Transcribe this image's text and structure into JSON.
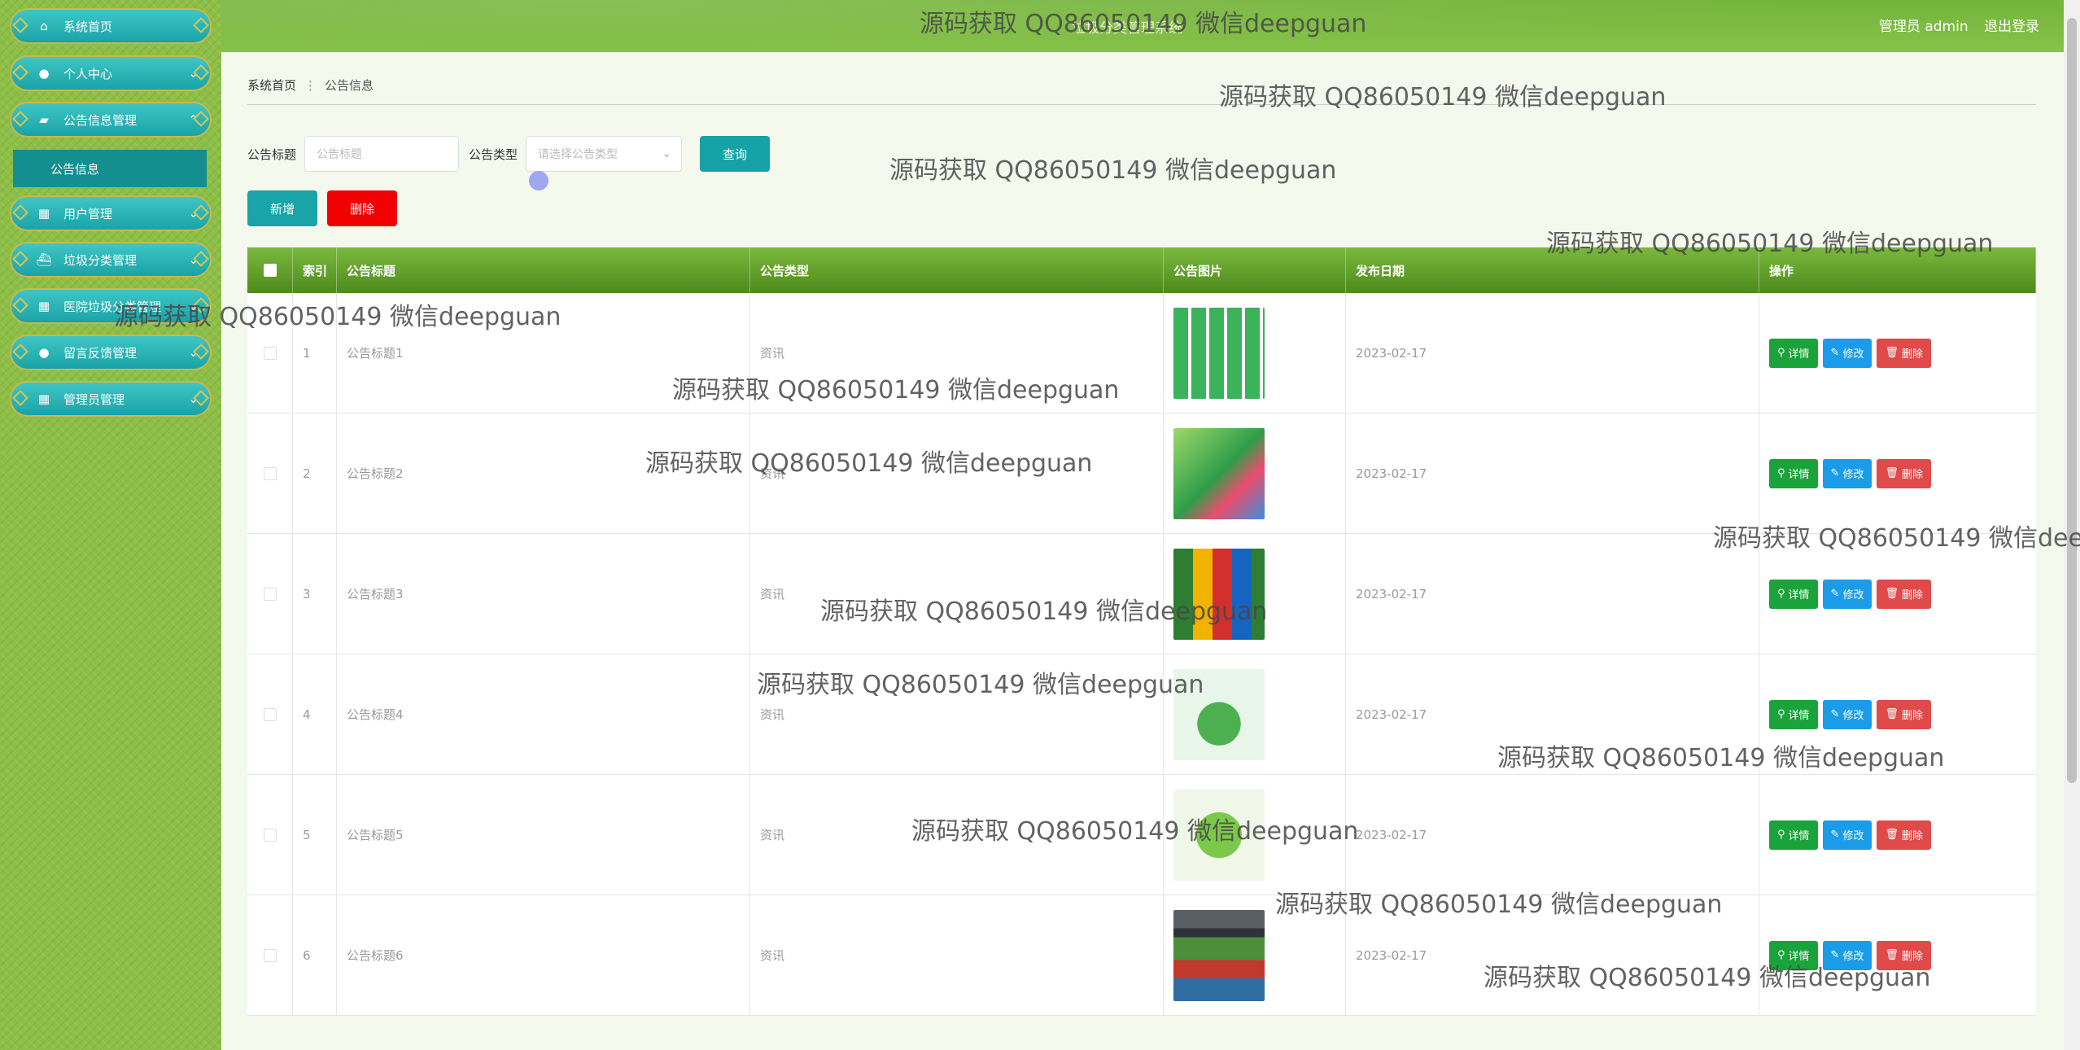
{
  "header": {
    "title": "垃圾分类管理系统",
    "user_label": "管理员 admin",
    "logout_label": "退出登录"
  },
  "sidebar": {
    "items": [
      {
        "label": "系统首页",
        "icon": "home-icon"
      },
      {
        "label": "个人中心",
        "icon": "user-icon"
      },
      {
        "label": "公告信息管理",
        "icon": "briefcase-icon"
      },
      {
        "label": "用户管理",
        "icon": "grid-icon"
      },
      {
        "label": "垃圾分类管理",
        "icon": "ship-icon"
      },
      {
        "label": "医院垃圾分类管理",
        "icon": "grid-icon"
      },
      {
        "label": "留言反馈管理",
        "icon": "user-icon"
      },
      {
        "label": "管理员管理",
        "icon": "grid-icon"
      }
    ],
    "submenu": {
      "label": "公告信息"
    }
  },
  "breadcrumb": {
    "home": "系统首页",
    "current": "公告信息"
  },
  "search": {
    "title_label": "公告标题",
    "title_placeholder": "公告标题",
    "type_label": "公告类型",
    "type_placeholder": "请选择公告类型",
    "query_label": "查询"
  },
  "actions": {
    "add_label": "新增",
    "delete_label": "删除"
  },
  "table": {
    "headers": {
      "index": "索引",
      "title": "公告标题",
      "type": "公告类型",
      "image": "公告图片",
      "date": "发布日期",
      "ops": "操作"
    },
    "rows": [
      {
        "index": "1",
        "title": "公告标题1",
        "type": "资讯",
        "date": "2023-02-17"
      },
      {
        "index": "2",
        "title": "公告标题2",
        "type": "资讯",
        "date": "2023-02-17"
      },
      {
        "index": "3",
        "title": "公告标题3",
        "type": "资讯",
        "date": "2023-02-17"
      },
      {
        "index": "4",
        "title": "公告标题4",
        "type": "资讯",
        "date": "2023-02-17"
      },
      {
        "index": "5",
        "title": "公告标题5",
        "type": "资讯",
        "date": "2023-02-17"
      },
      {
        "index": "6",
        "title": "公告标题6",
        "type": "资讯",
        "date": "2023-02-17"
      }
    ],
    "op_labels": {
      "detail": "详情",
      "edit": "修改",
      "delete": "删除"
    }
  },
  "watermark": "源码获取 QQ86050149 微信deepguan",
  "colors": {
    "sidebar_bg": "#8dbf47",
    "menu_teal": "#1aa3a6",
    "header_green": "#74b43a",
    "danger": "#f00000"
  }
}
